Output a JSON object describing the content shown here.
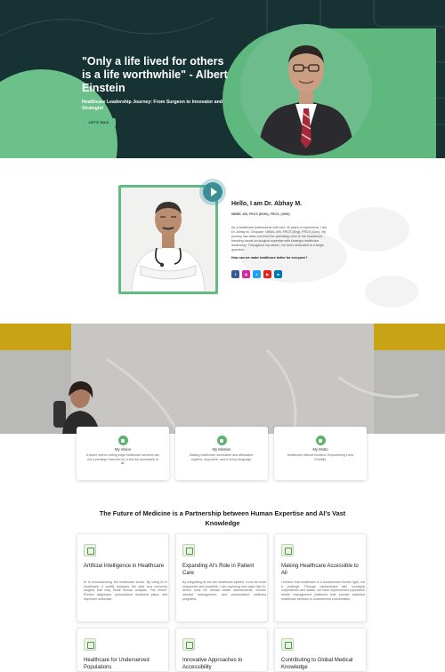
{
  "hero": {
    "quote": "\"Only a life lived for others is a life worthwhile\" - Albert Einstein",
    "subtitle": "Healthcare Leadership Journey: From Surgeon to Innovator and Strategist",
    "cta_label": "LET'S TALK"
  },
  "about": {
    "title": "Hello, I am Dr. Abhay M.",
    "degrees": "MBBS, MS, FRCS (EDIN), FRCS, (GEN)",
    "bio": "As a healthcare professional with over 30 years of experience, I am Dr. Abhay M. Chopade, MBBS, MS, FRCS (Eng), FRCS (Gen). My journey has taken me from the operating room to the boardroom, blending hands-on surgical expertise with strategic healthcare leadership. Throughout my career, I've been dedicated to a single question:",
    "question": "How can we make healthcare better for everyone?",
    "socials": [
      {
        "icon": "facebook-icon",
        "glyph": "f",
        "color": "#3b5998"
      },
      {
        "icon": "instagram-icon",
        "glyph": "◎",
        "color": "#d6249f"
      },
      {
        "icon": "twitter-icon",
        "glyph": "t",
        "color": "#1da1f2"
      },
      {
        "icon": "youtube-icon",
        "glyph": "▶",
        "color": "#e62117"
      },
      {
        "icon": "linkedin-icon",
        "glyph": "in",
        "color": "#0077b5"
      }
    ]
  },
  "values": [
    {
      "title": "My Vision",
      "text": "A future where cutting-edge healthcare services are not a privilege reserved for a few but accessible to all."
    },
    {
      "title": "My Mission",
      "text": "Making healthcare accessible and affordable: anytime, anywhere, and in every language."
    },
    {
      "title": "My Motto",
      "text": "Healthcare without Borders: Empowering Lives Globally."
    }
  ],
  "future": {
    "title": "The Future of Medicine is a Partnership between Human Expertise and AI's Vast Knowledge",
    "cards": [
      {
        "title": "Artificial Intelligence in Healthcare",
        "text": "AI is revolutionizing the healthcare sector. By using AI in healthcare, it swiftly analyzes the data and uncovers insights that may elude human analysis. The result? Precise diagnoses, personalized treatment plans, and improved outcomes."
      },
      {
        "title": "Expanding AI's Role in Patient Care",
        "text": "By integrating AI into the healthcare system, it can be more responsive and proactive. I am exploring new ways like AI-driven tools for mental health assessments, chronic disease management, and personalized wellness programs."
      },
      {
        "title": "Making Healthcare Accessible to All",
        "text": "I believe that healthcare is a fundamental human right, not a privilege. Through partnerships with municipal corporations and states, we have implemented population health management platforms that provide essential healthcare services to underserved communities."
      },
      {
        "title": "Healthcare for Underserved Populations",
        "text": ""
      },
      {
        "title": "Innovative Approaches to Accessibility",
        "text": ""
      },
      {
        "title": "Contributing to Global Medical Knowledge",
        "text": ""
      }
    ]
  },
  "colors": {
    "hero_bg": "#173232",
    "accent_green": "#63bb84",
    "banner_yellow": "#c9a316",
    "teal": "#3a8f97"
  }
}
